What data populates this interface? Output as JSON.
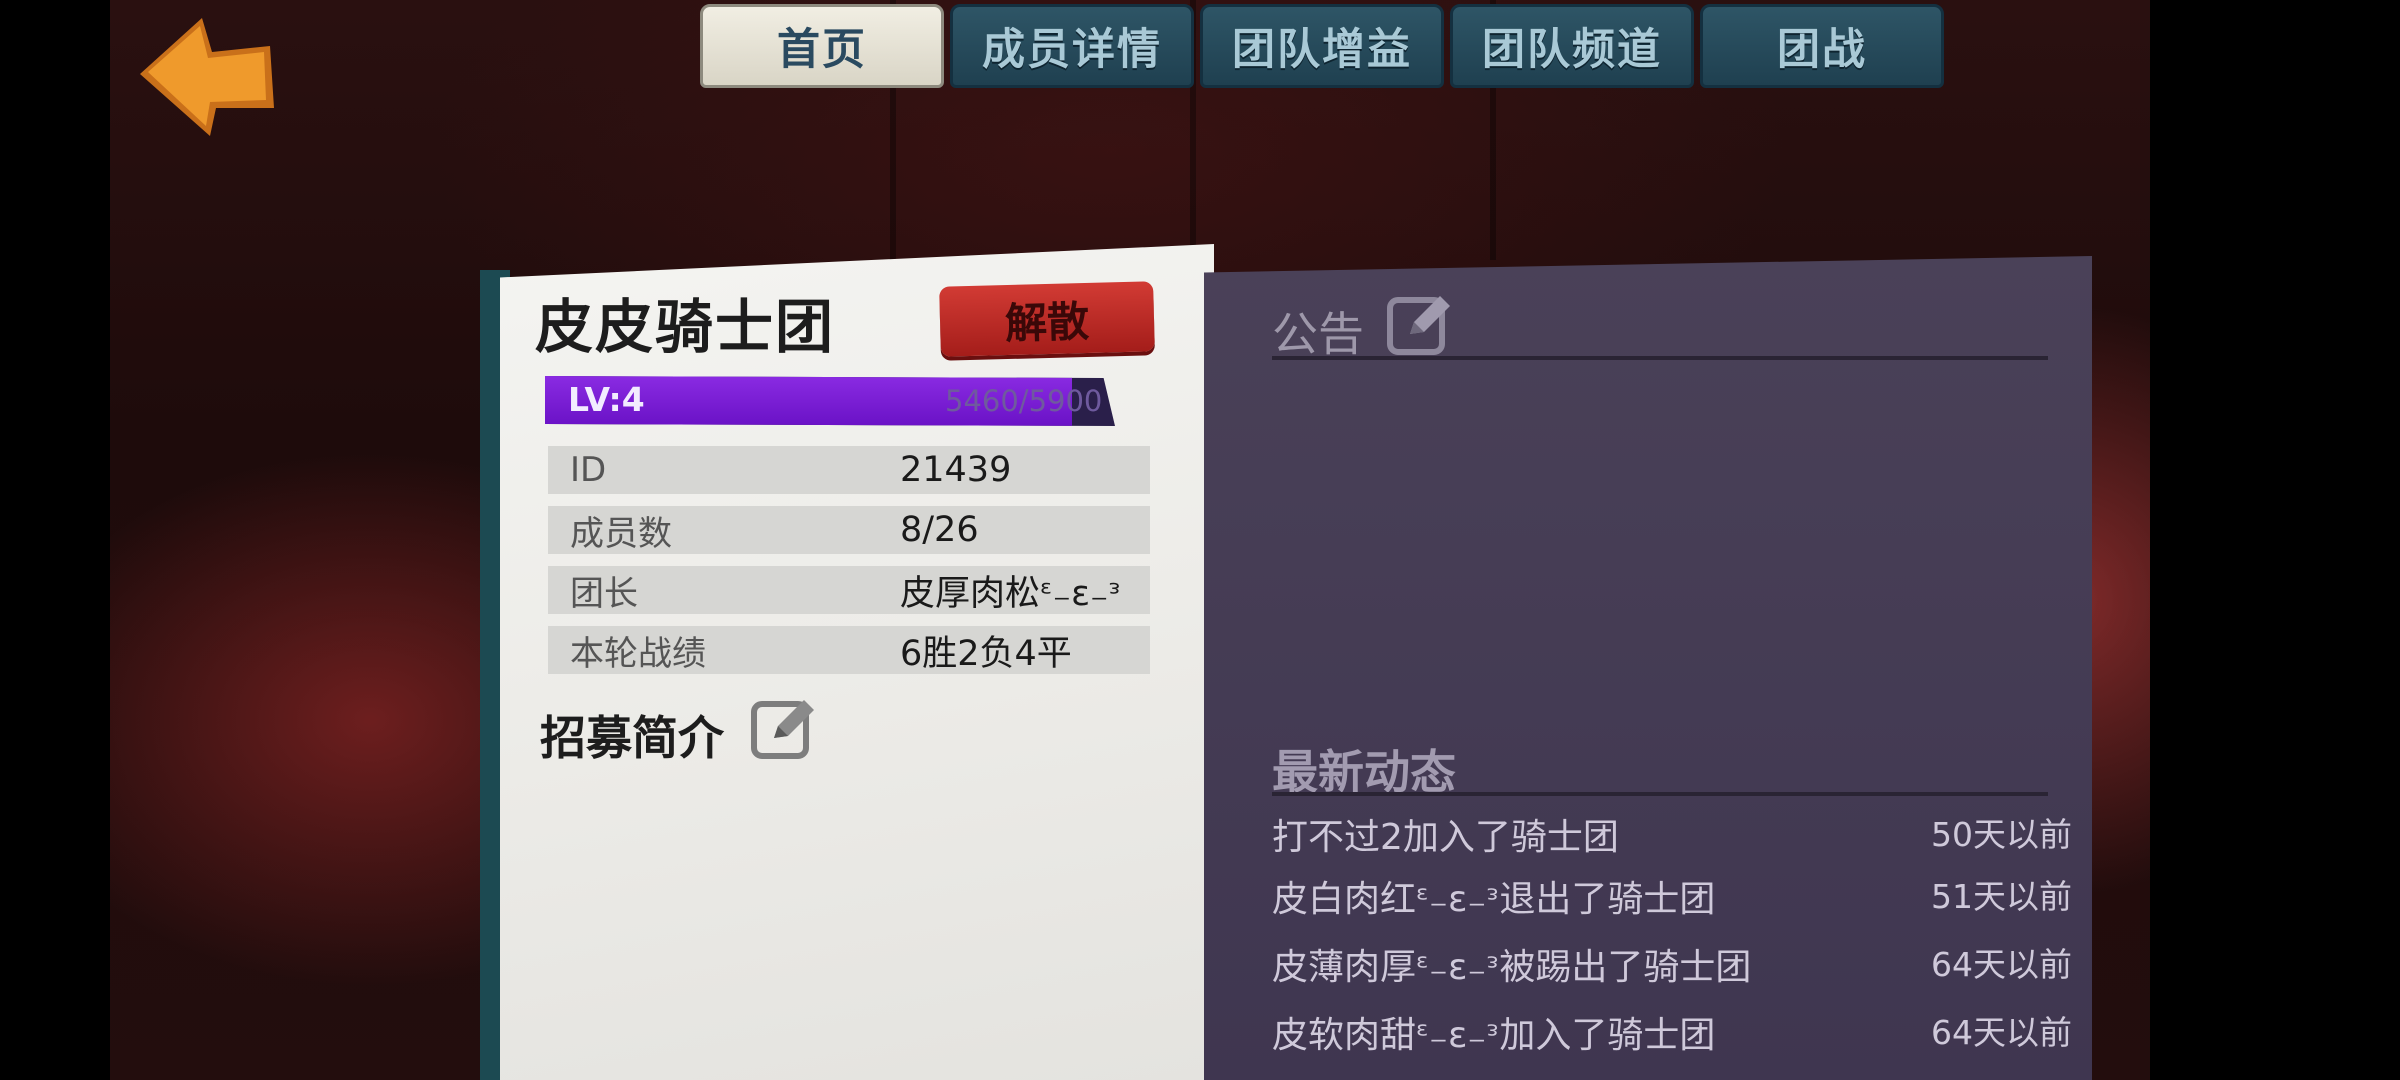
{
  "tabs": [
    {
      "label": "首页",
      "active": true
    },
    {
      "label": "成员详情",
      "active": false
    },
    {
      "label": "团队增益",
      "active": false
    },
    {
      "label": "团队频道",
      "active": false
    },
    {
      "label": "团战",
      "active": false
    }
  ],
  "guild": {
    "name": "皮皮骑士团",
    "disband_label": "解散",
    "level_label": "LV:4",
    "exp_text": "5460/5900",
    "exp_fraction": 0.9254,
    "info": [
      {
        "label": "ID",
        "value": "21439"
      },
      {
        "label": "成员数",
        "value": "8/26"
      },
      {
        "label": "团长",
        "value": "皮厚肉松ᵋ₋ε₋ᵌ"
      },
      {
        "label": "本轮战绩",
        "value": "6胜2负4平"
      }
    ],
    "recruit_title": "招募简介"
  },
  "notice": {
    "title": "公告"
  },
  "news": {
    "title": "最新动态",
    "items": [
      {
        "text": "打不过2加入了骑士团",
        "time": "50天以前"
      },
      {
        "text": "皮白肉红ᵋ₋ε₋ᵌ退出了骑士团",
        "time": "51天以前"
      },
      {
        "text": "皮薄肉厚ᵋ₋ε₋ᵌ被踢出了骑士团",
        "time": "64天以前"
      },
      {
        "text": "皮软肉甜ᵋ₋ε₋ᵌ加入了骑士团",
        "time": "64天以前"
      }
    ]
  },
  "colors": {
    "accent_purple": "#7a1fd6",
    "disband_red": "#c0302a",
    "back_orange": "#e38a1c"
  }
}
